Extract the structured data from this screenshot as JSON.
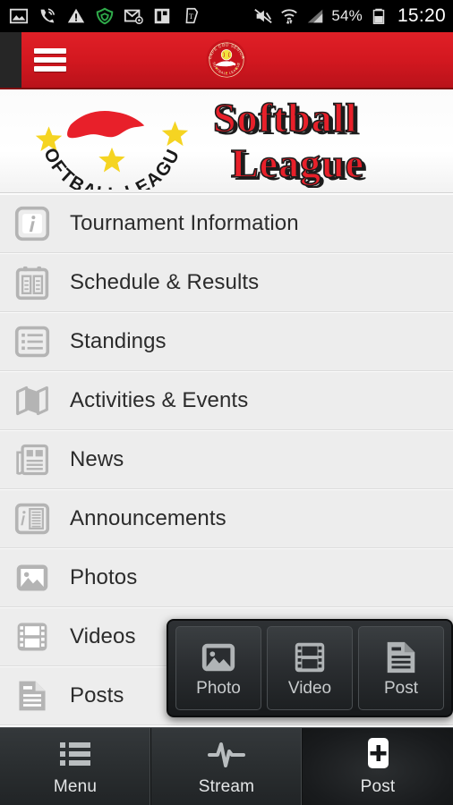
{
  "statusbar": {
    "left_icons": [
      {
        "name": "screenshot-icon"
      },
      {
        "name": "wifi-calling-icon"
      },
      {
        "name": "warning-triangle-icon"
      },
      {
        "name": "shield-icon"
      },
      {
        "name": "email-icon"
      },
      {
        "name": "flipboard-icon"
      },
      {
        "name": "tmobile-key-icon"
      }
    ],
    "right_icons": [
      {
        "name": "mute-icon"
      },
      {
        "name": "wifi-transfer-icon"
      },
      {
        "name": "signal-bars-icon"
      }
    ],
    "battery_percent": "54%",
    "clock": "15:20"
  },
  "header": {
    "menu_button_name": "hamburger-menu-button",
    "logo_alt": "CAPE COD SENIOR SOFTBALL LEAGUE",
    "badge_text_top": "CAPE COD SENIOR",
    "badge_text_bottom": "SOFTBALL LEAGUE",
    "accent_color": "#d41820"
  },
  "banner": {
    "arc_text": "SOFTBALL LEAGUE",
    "title_line1": "Softball",
    "title_line2": "League",
    "title_color": "#e8202a"
  },
  "menu": {
    "items": [
      {
        "icon": "info-square-icon",
        "label": "Tournament Information"
      },
      {
        "icon": "calendar-icon",
        "label": "Schedule & Results"
      },
      {
        "icon": "list-document-icon",
        "label": "Standings"
      },
      {
        "icon": "map-icon",
        "label": "Activities & Events"
      },
      {
        "icon": "newspaper-icon",
        "label": "News"
      },
      {
        "icon": "announcement-icon",
        "label": "Announcements"
      },
      {
        "icon": "photo-icon",
        "label": "Photos"
      },
      {
        "icon": "film-icon",
        "label": "Videos"
      },
      {
        "icon": "post-document-icon",
        "label": "Posts"
      }
    ]
  },
  "popup": {
    "buttons": [
      {
        "icon": "photo-icon",
        "label": "Photo"
      },
      {
        "icon": "film-icon",
        "label": "Video"
      },
      {
        "icon": "post-document-icon",
        "label": "Post"
      }
    ]
  },
  "bottomnav": {
    "tabs": [
      {
        "icon": "list-icon",
        "label": "Menu",
        "active": false
      },
      {
        "icon": "pulse-icon",
        "label": "Stream",
        "active": false
      },
      {
        "icon": "plus-icon",
        "label": "Post",
        "active": true
      }
    ]
  }
}
